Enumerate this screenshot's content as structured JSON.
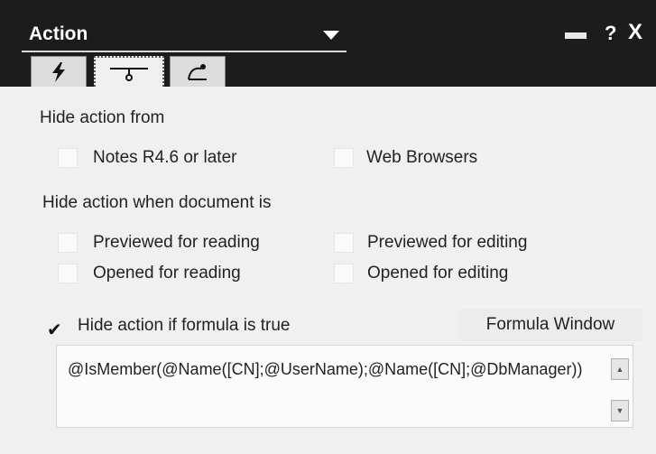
{
  "window": {
    "title": "Action",
    "help_label": "?",
    "close_label": "X"
  },
  "tabs": [
    {
      "icon": "lightning-icon"
    },
    {
      "icon": "hide-when-icon"
    },
    {
      "icon": "pen-icon"
    }
  ],
  "hide_from": {
    "heading": "Hide action from",
    "notes_label": "Notes R4.6 or later",
    "notes_checked": false,
    "web_label": "Web Browsers",
    "web_checked": false
  },
  "hide_when": {
    "heading": "Hide action when document is",
    "previewed_reading": "Previewed for reading",
    "previewed_editing": "Previewed for editing",
    "opened_reading": "Opened for reading",
    "opened_editing": "Opened for editing"
  },
  "formula": {
    "check_label": "Hide action if formula is true",
    "checked": true,
    "check_glyph": "✔",
    "window_button": "Formula Window",
    "value": "@IsMember(@Name([CN];@UserName);@Name([CN];@DbManager))"
  }
}
